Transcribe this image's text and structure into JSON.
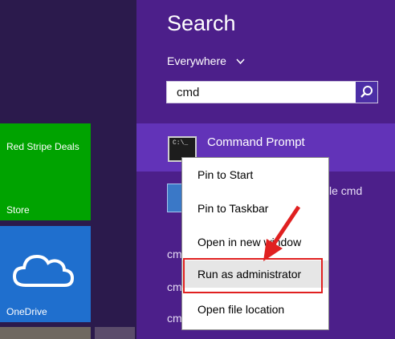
{
  "start": {
    "tiles": [
      {
        "title": "Red Stripe Deals",
        "label": "Store"
      },
      {
        "label": "OneDrive"
      }
    ]
  },
  "search": {
    "title": "Search",
    "scope": "Everywhere",
    "query": "cmd"
  },
  "results": [
    {
      "title": "Command Prompt",
      "icon": "cmd-icon"
    },
    {
      "title_visible": "le cmd",
      "icon": "document-icon"
    },
    {
      "partial": "cm"
    },
    {
      "partial": "cm"
    },
    {
      "partial": "cm"
    }
  ],
  "context_menu": {
    "items": [
      "Pin to Start",
      "Pin to Taskbar",
      "Open in new window",
      "Run as administrator",
      "Open file location"
    ]
  },
  "colors": {
    "accent": "#4c1f8a",
    "selected": "#6233b8",
    "store_tile": "#00a300",
    "onedrive_tile": "#1f6fce",
    "annotation": "#e02020"
  }
}
